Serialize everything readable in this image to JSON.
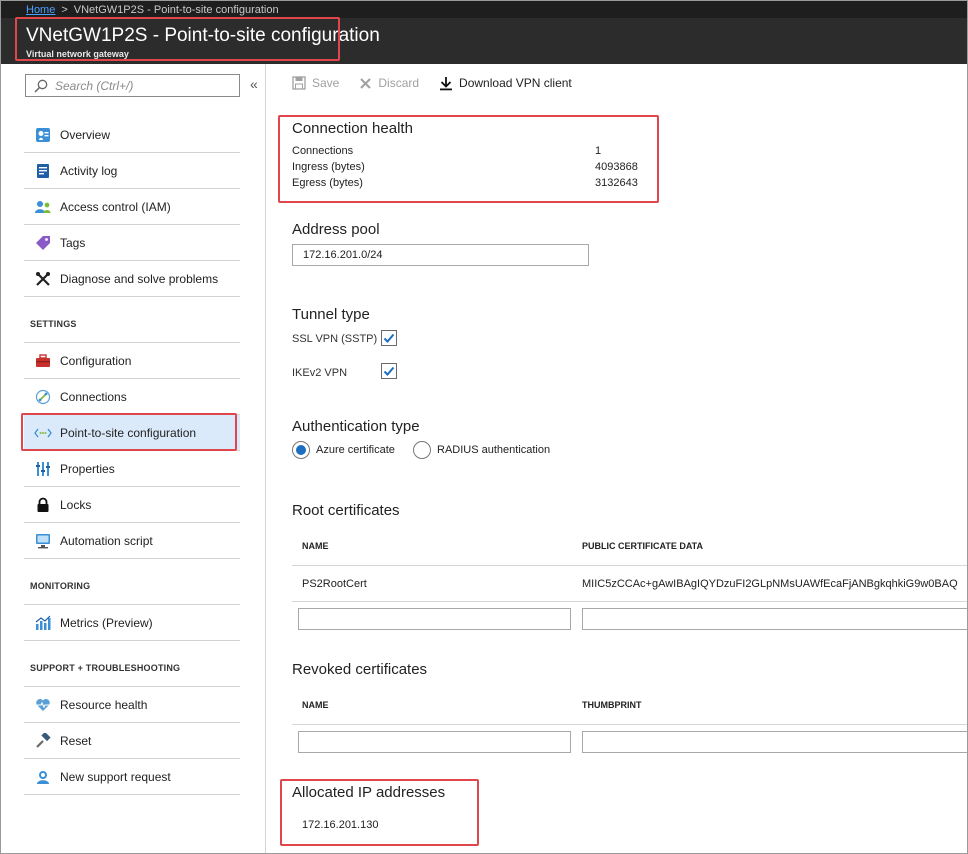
{
  "breadcrumb": {
    "home": "Home",
    "current": "VNetGW1P2S - Point-to-site configuration"
  },
  "header": {
    "title": "VNetGW1P2S - Point-to-site configuration",
    "subtitle": "Virtual network gateway"
  },
  "sidebar": {
    "search_placeholder": "Search (Ctrl+/)",
    "collapse_glyph": "«",
    "items": [
      {
        "label": "Overview",
        "icon": "overview-icon"
      },
      {
        "label": "Activity log",
        "icon": "activity-log-icon"
      },
      {
        "label": "Access control (IAM)",
        "icon": "access-control-icon"
      },
      {
        "label": "Tags",
        "icon": "tag-icon"
      },
      {
        "label": "Diagnose and solve problems",
        "icon": "wrench-icon"
      }
    ],
    "settings_header": "SETTINGS",
    "settings_items": [
      {
        "label": "Configuration",
        "icon": "toolbox-icon"
      },
      {
        "label": "Connections",
        "icon": "connections-icon"
      },
      {
        "label": "Point-to-site configuration",
        "icon": "point-to-site-icon",
        "active": true
      },
      {
        "label": "Properties",
        "icon": "properties-icon"
      },
      {
        "label": "Locks",
        "icon": "lock-icon"
      },
      {
        "label": "Automation script",
        "icon": "automation-icon"
      }
    ],
    "monitoring_header": "MONITORING",
    "monitoring_items": [
      {
        "label": "Metrics (Preview)",
        "icon": "metrics-icon"
      }
    ],
    "support_header": "SUPPORT + TROUBLESHOOTING",
    "support_items": [
      {
        "label": "Resource health",
        "icon": "heart-icon"
      },
      {
        "label": "Reset",
        "icon": "hammer-icon"
      },
      {
        "label": "New support request",
        "icon": "support-icon"
      }
    ]
  },
  "toolbar": {
    "save": "Save",
    "discard": "Discard",
    "download": "Download VPN client"
  },
  "connection_health": {
    "title": "Connection health",
    "rows": [
      {
        "label": "Connections",
        "value": "1"
      },
      {
        "label": "Ingress (bytes)",
        "value": "4093868"
      },
      {
        "label": "Egress (bytes)",
        "value": "3132643"
      }
    ]
  },
  "address_pool": {
    "title": "Address pool",
    "value": "172.16.201.0/24"
  },
  "tunnel_type": {
    "title": "Tunnel type",
    "options": [
      {
        "label": "SSL VPN (SSTP)",
        "checked": true
      },
      {
        "label": "IKEv2 VPN",
        "checked": true
      }
    ]
  },
  "authentication": {
    "title": "Authentication type",
    "options": [
      {
        "label": "Azure certificate",
        "selected": true
      },
      {
        "label": "RADIUS authentication",
        "selected": false
      }
    ]
  },
  "root_certificates": {
    "title": "Root certificates",
    "col_name": "NAME",
    "col_data": "PUBLIC CERTIFICATE DATA",
    "rows": [
      {
        "name": "PS2RootCert",
        "data": "MIIC5zCCAc+gAwIBAgIQYDzuFI2GLpNMsUAWfEcaFjANBgkqhkiG9w0BAQ"
      }
    ]
  },
  "revoked_certificates": {
    "title": "Revoked certificates",
    "col_name": "NAME",
    "col_thumb": "THUMBPRINT"
  },
  "allocated_ips": {
    "title": "Allocated IP addresses",
    "value": "172.16.201.130"
  },
  "colors": {
    "accent": "#1b6ec2",
    "highlight": "#e0474c",
    "header_bg": "#2c2c2c"
  }
}
